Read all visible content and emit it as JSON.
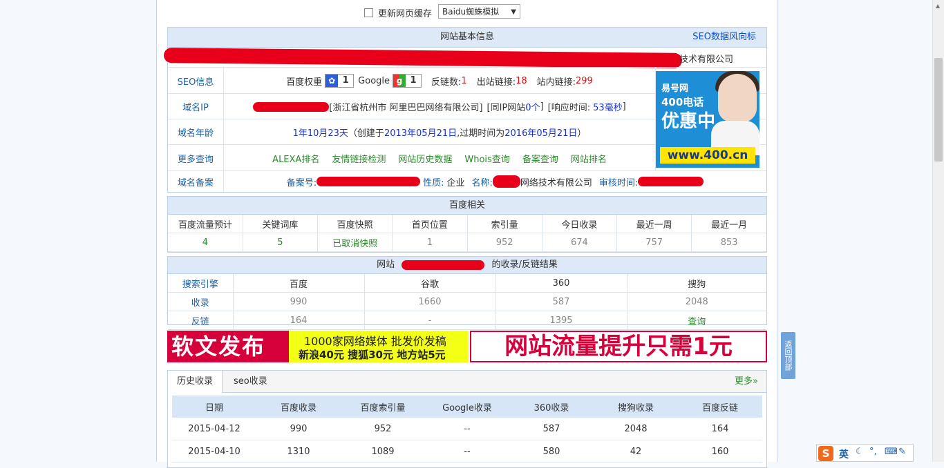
{
  "toolbar": {
    "refresh_label": "更新网页缓存",
    "select_value": "Baidu蜘蛛模拟"
  },
  "basic": {
    "title": "网站基本信息",
    "seo_link": "SEO数据风向标",
    "company_suffix": "技术有限公司",
    "rows": {
      "seo": {
        "label": "SEO信息",
        "bd_weight_label": "百度权重",
        "bd_weight": "1",
        "google_label": "Google",
        "google_pr": "1",
        "backlinks_label": "反链数:",
        "backlinks": "1",
        "outlinks_label": "出站链接:",
        "outlinks": "18",
        "inlinks_label": "站内链接:",
        "inlinks": "299"
      },
      "ip": {
        "label": "域名IP",
        "location": "[浙江省杭州市 阿里巴巴网络有限公司]",
        "same_ip_pre": "[同IP网站",
        "same_ip": "0个",
        "same_ip_post": "]",
        "resp_pre": "[响应时间:",
        "resp": "53毫秒",
        "resp_post": "]"
      },
      "age": {
        "label": "域名年龄",
        "age": "1年10月23天",
        "created_pre": "（创建于",
        "created": "2013年05月21日",
        "expire_pre": ",过期时间为",
        "expire": "2016年05月21日",
        "post": "）"
      },
      "more": {
        "label": "更多查询",
        "links": [
          "ALEXA排名",
          "友情链接检测",
          "网站历史数据",
          "Whois查询",
          "备案查询",
          "网站排名"
        ]
      },
      "icp": {
        "label": "域名备案",
        "icp_label": "备案号:",
        "nature_label": "性质:",
        "nature": "企业",
        "name_label": "名称:",
        "name_suffix": "网络技术有限公司",
        "audit_label": "审核时间:"
      }
    },
    "ad": {
      "brand": "易号网",
      "line1": "400电话",
      "line2": "优惠中",
      "url": "www.400.cn"
    }
  },
  "baidu": {
    "title": "百度相关",
    "headers": [
      "百度流量预计",
      "关键词库",
      "百度快照",
      "首页位置",
      "索引量",
      "今日收录",
      "最近一周",
      "最近一月"
    ],
    "values": [
      "4",
      "5",
      "已取消快照",
      "1",
      "952",
      "674",
      "757",
      "853"
    ]
  },
  "result": {
    "title_pre": "网站",
    "title_post": "的收录/反链结果",
    "headers": [
      "搜索引擎",
      "百度",
      "谷歌",
      "360",
      "搜狗"
    ],
    "rows": [
      [
        "收录",
        "990",
        "1660",
        "587",
        "2048"
      ],
      [
        "反链",
        "164",
        "-",
        "1395",
        "查询"
      ]
    ]
  },
  "banner": {
    "left": "软文发布",
    "mid1": "1000家网络媒体  批发价发稿",
    "mid2": "新浪40元 搜狐30元 地方站5元",
    "right": "网站流量提升只需1元"
  },
  "history": {
    "tabs": [
      "历史收录",
      "seo收录"
    ],
    "more": "更多»",
    "headers": [
      "日期",
      "百度收录",
      "百度索引量",
      "Google收录",
      "360收录",
      "搜狗收录",
      "百度反链"
    ],
    "rows": [
      [
        "2015-04-12",
        "990",
        "952",
        "--",
        "587",
        "2048",
        "164"
      ],
      [
        "2015-04-10",
        "1310",
        "1089",
        "--",
        "580",
        "42",
        "160"
      ]
    ]
  },
  "back_top": "返回顶部",
  "ime": {
    "logo": "S",
    "mode": "英"
  }
}
